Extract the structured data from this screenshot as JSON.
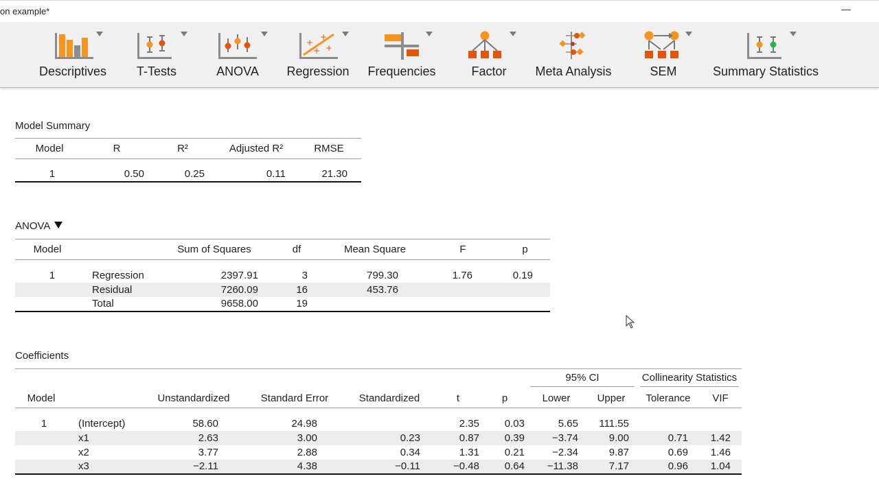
{
  "window": {
    "title": "on example*",
    "minimize_symbol": "—"
  },
  "ribbon": {
    "tools": [
      {
        "id": "descriptives",
        "label": "Descriptives",
        "icon": "descriptives-bar-icon"
      },
      {
        "id": "ttests",
        "label": "T-Tests",
        "icon": "ttests-icon"
      },
      {
        "id": "anova",
        "label": "ANOVA",
        "icon": "anova-icon"
      },
      {
        "id": "regression",
        "label": "Regression",
        "icon": "regression-icon"
      },
      {
        "id": "frequencies",
        "label": "Frequencies",
        "icon": "frequencies-icon"
      },
      {
        "id": "factor",
        "label": "Factor",
        "icon": "factor-icon"
      },
      {
        "id": "meta",
        "label": "Meta Analysis",
        "icon": "meta-analysis-icon"
      },
      {
        "id": "sem",
        "label": "SEM",
        "icon": "sem-icon"
      },
      {
        "id": "summary",
        "label": "Summary Statistics",
        "icon": "summary-statistics-icon"
      }
    ],
    "colors": {
      "orange": "#f7941d",
      "dark_orange": "#e2560c",
      "red": "#c0392b",
      "gray": "#8c8c8c",
      "green": "#2db34a"
    }
  },
  "model_summary": {
    "title": "Model Summary",
    "headers": [
      "Model",
      "R",
      "R²",
      "Adjusted R²",
      "RMSE"
    ],
    "rows": [
      [
        "1",
        "0.50",
        "0.25",
        "0.11",
        "21.30"
      ]
    ]
  },
  "anova": {
    "title": "ANOVA",
    "headers": [
      "Model",
      "",
      "Sum of Squares",
      "df",
      "Mean Square",
      "F",
      "p"
    ],
    "rows": [
      [
        "1",
        "Regression",
        "2397.91",
        "3",
        "799.30",
        "1.76",
        "0.19"
      ],
      [
        "",
        "Residual",
        "7260.09",
        "16",
        "453.76",
        "",
        ""
      ],
      [
        "",
        "Total",
        "9658.00",
        "19",
        "",
        "",
        ""
      ]
    ]
  },
  "coefficients": {
    "title": "Coefficients",
    "group_headers": {
      "ci": "95% CI",
      "collinearity": "Collinearity Statistics"
    },
    "headers": [
      "Model",
      "",
      "Unstandardized",
      "Standard Error",
      "Standardized",
      "t",
      "p",
      "Lower",
      "Upper",
      "Tolerance",
      "VIF"
    ],
    "rows": [
      [
        "1",
        "(Intercept)",
        "58.60",
        "24.98",
        "",
        "2.35",
        "0.03",
        "5.65",
        "111.55",
        "",
        ""
      ],
      [
        "",
        "x1",
        "2.63",
        "3.00",
        "0.23",
        "0.87",
        "0.39",
        "−3.74",
        "9.00",
        "0.71",
        "1.42"
      ],
      [
        "",
        "x2",
        "3.77",
        "2.88",
        "0.34",
        "1.31",
        "0.21",
        "−2.34",
        "9.87",
        "0.69",
        "1.46"
      ],
      [
        "",
        "x3",
        "−2.11",
        "4.38",
        "−0.11",
        "−0.48",
        "0.64",
        "−11.38",
        "7.17",
        "0.96",
        "1.04"
      ]
    ]
  }
}
